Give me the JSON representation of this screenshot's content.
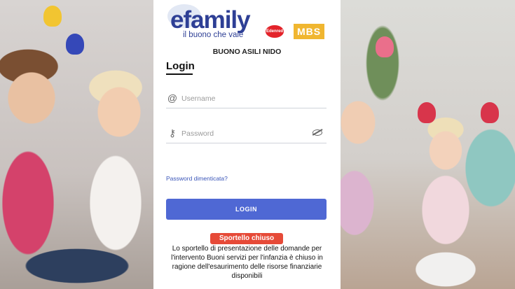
{
  "brand": {
    "logo_word": "efamily",
    "tagline": "il buono che vale",
    "partner_logo_1": "Edenred",
    "partner_logo_2": "MBS"
  },
  "subtitle": "BUONO ASILI NIDO",
  "login": {
    "heading": "Login",
    "username": {
      "placeholder": "Username",
      "value": "",
      "icon": "at-icon"
    },
    "password": {
      "placeholder": "Password",
      "value": "",
      "icon": "key-icon",
      "toggle_icon": "eye-slash-icon"
    },
    "forgot_link": "Password dimenticata?",
    "submit_label": "LOGIN"
  },
  "status": {
    "badge": "Sportello chiuso",
    "message": "Lo sportello di presentazione delle domande per l'intervento Buoni servizi per l'infanzia è chiuso in ragione dell'esaurimento delle risorse finanziarie disponibili"
  },
  "colors": {
    "brand_blue": "#2e3f95",
    "button": "#4f68d4",
    "badge": "#e64a38",
    "link": "#3a55b8"
  }
}
